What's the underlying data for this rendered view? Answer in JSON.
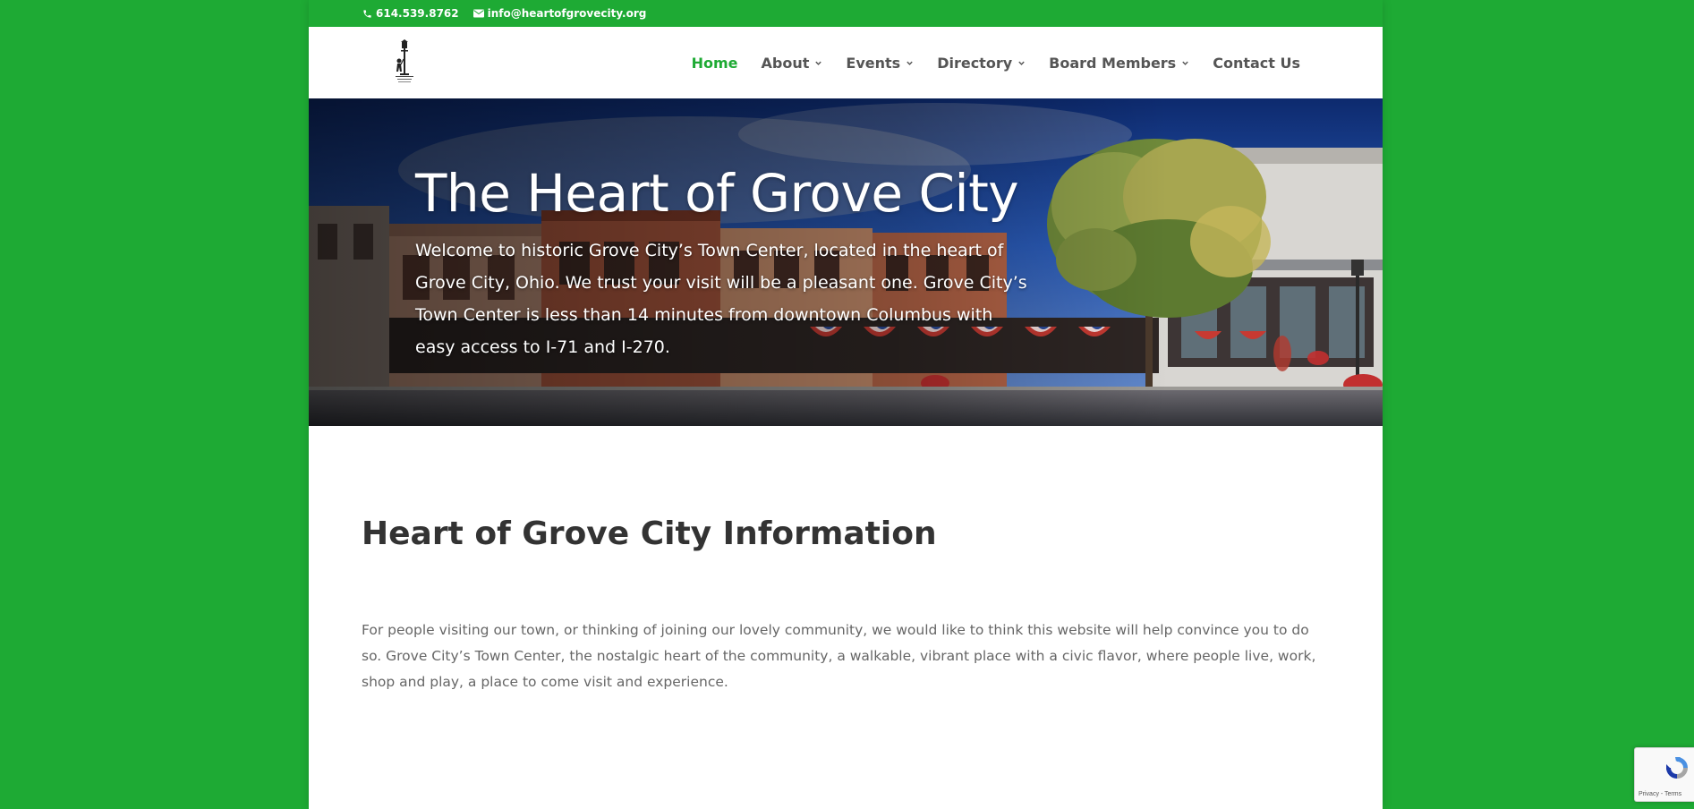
{
  "colors": {
    "brand_green": "#1eaa34",
    "nav_text": "#555555",
    "heading_text": "#333333",
    "body_text": "#666666"
  },
  "topbar": {
    "phone": "614.539.8762",
    "phone_icon": "phone-icon",
    "email": "info@heartofgrovecity.org",
    "email_icon": "envelope-icon"
  },
  "header": {
    "logo_icon": "lamppost-logo-icon",
    "nav": [
      {
        "label": "Home",
        "active": true,
        "has_dropdown": false
      },
      {
        "label": "About",
        "active": false,
        "has_dropdown": true
      },
      {
        "label": "Events",
        "active": false,
        "has_dropdown": true
      },
      {
        "label": "Directory",
        "active": false,
        "has_dropdown": true
      },
      {
        "label": "Board Members",
        "active": false,
        "has_dropdown": true
      },
      {
        "label": "Contact Us",
        "active": false,
        "has_dropdown": false
      }
    ]
  },
  "hero": {
    "title": "The Heart of Grove City",
    "text": "Welcome to historic Grove City’s Town Center, located in the heart of Grove City, Ohio. We trust your visit will be a pleasant one. Grove City’s Town Center is less than 14 minutes from downtown Columbus with easy access to I-71 and I-270."
  },
  "info": {
    "title": "Heart of Grove City Information",
    "text": "For people visiting our town, or thinking of joining our lovely community, we would like to think this website will help convince you to do so. Grove City’s Town Center, the nostalgic heart of the community, a walkable, vibrant place with a civic flavor, where people live, work, shop and play, a place to come visit and experience."
  },
  "recaptcha": {
    "icon": "recaptcha-icon",
    "text": "Privacy - Terms"
  }
}
